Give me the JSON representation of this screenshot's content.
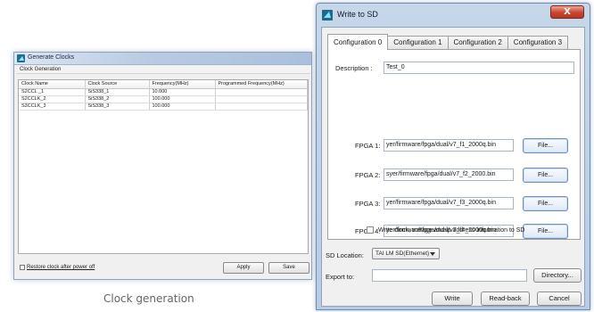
{
  "generate_clocks": {
    "title": "Generate Clocks",
    "section_label": "Clock Generation",
    "columns": [
      "Clock Name",
      "Clock Source",
      "Frequency(MHz)",
      "Programmed Frequency(MHz)"
    ],
    "rows": [
      [
        "S2CCL _1",
        "SiS338_1",
        "10.000",
        ""
      ],
      [
        "S2CCLK_2",
        "SiS338_2",
        "100.000",
        ""
      ],
      [
        "S3CCLK_3",
        "SiS338_3",
        "100.000",
        ""
      ]
    ],
    "restore_checkbox_label": "Restore clock after power off",
    "apply_label": "Apply",
    "save_label": "Save",
    "caption": "Clock generation"
  },
  "write_to_sd": {
    "title": "Write to SD",
    "close_label": "X",
    "tabs": [
      "Configuration 0",
      "Configuration 1",
      "Configuration 2",
      "Configuration 3"
    ],
    "active_tab": 0,
    "description_label": "Description :",
    "description_value": "Test_0",
    "fpga": [
      {
        "label": "FPGA 1:",
        "path": "yer/firmware/fpga/dual/v7_f1_2000q.bin",
        "button": "File..."
      },
      {
        "label": "FPGA 2:",
        "path": "syer/firmware/fpga/dual/v7_f2_2000.bin",
        "button": "File..."
      },
      {
        "label": "FPGA 3:",
        "path": "yer/firmware/fpga/dual/v7_f3_2000q.bin",
        "button": "File..."
      },
      {
        "label": "FPGA 4:",
        "path": "yer/firmware/fpga/dual/v7_f4_2000q.bin",
        "button": "File..."
      }
    ],
    "write_info_checkbox_label": "Write clock, voltage and ip address information to SD",
    "sd_location_label": "SD Location:",
    "sd_location_value": "TAI LM SD(Ethernet)",
    "export_label": "Export to:",
    "export_value": "",
    "directory_label": "Directory...",
    "write_label": "Write",
    "readback_label": "Read-back",
    "cancel_label": "Cancel"
  }
}
